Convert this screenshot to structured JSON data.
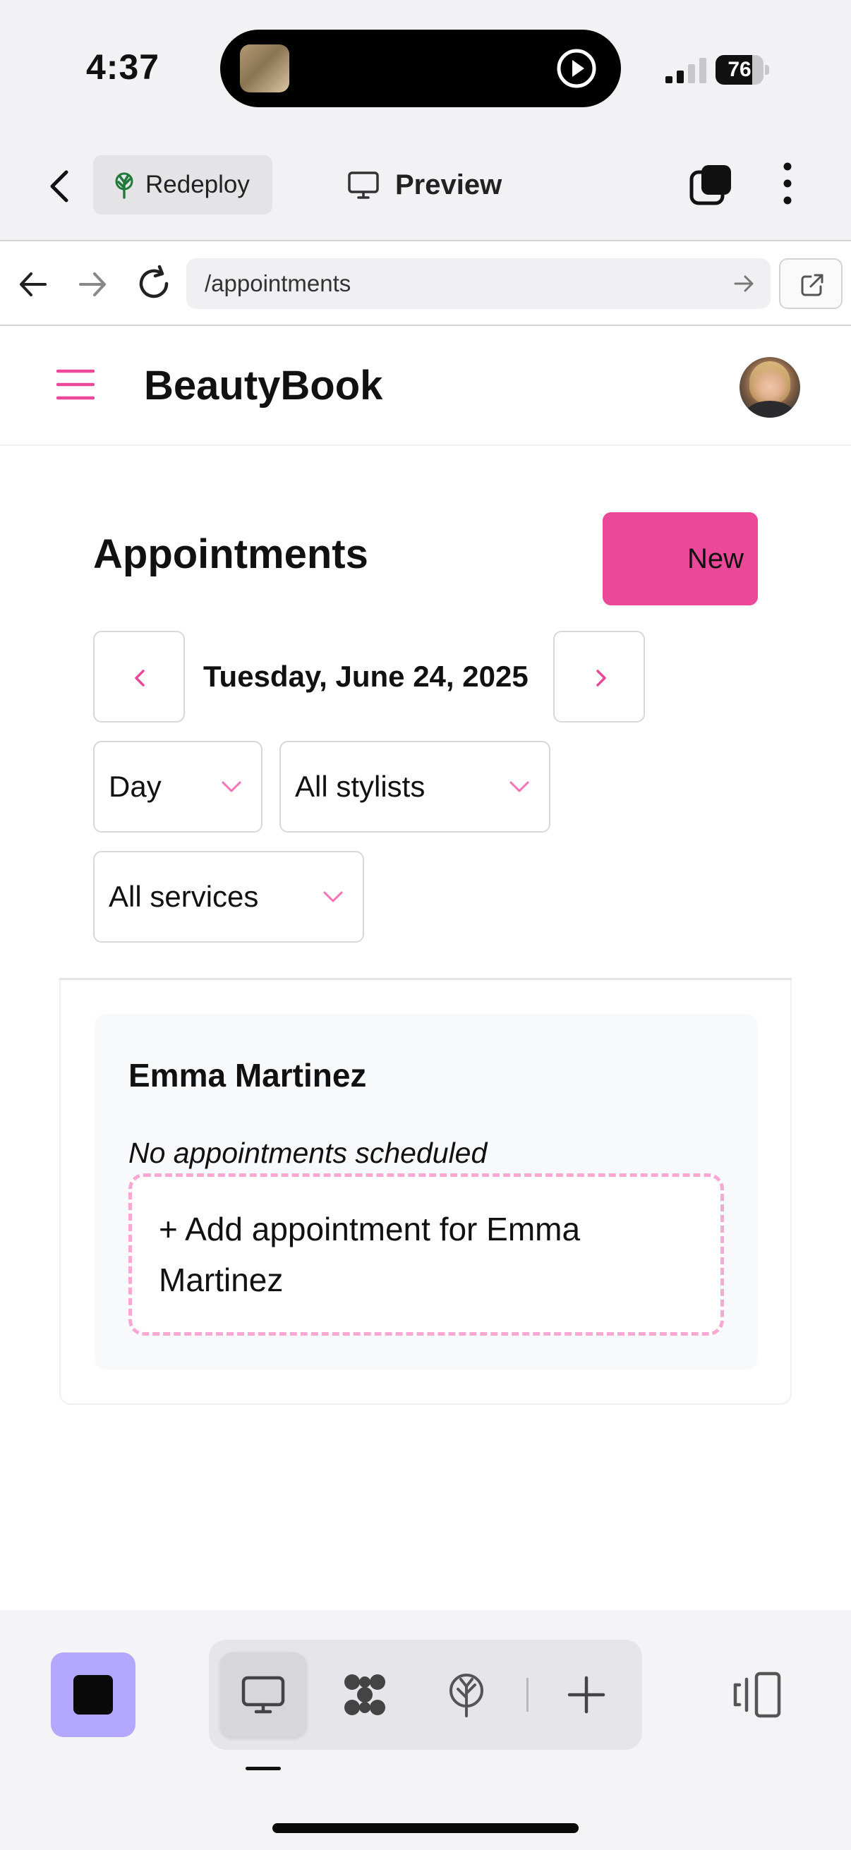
{
  "status_bar": {
    "time": "4:37",
    "battery": "76",
    "battery_level": 0.76
  },
  "app_bar": {
    "redeploy_label": "Redeploy",
    "preview_label": "Preview"
  },
  "browser": {
    "url": "/appointments"
  },
  "site": {
    "brand": "BeautyBook"
  },
  "page": {
    "title": "Appointments",
    "new_button_label": "New",
    "date_label": "Tuesday, June 24, 2025",
    "view_select": "Day",
    "stylist_select": "All stylists",
    "service_select": "All services"
  },
  "schedule": {
    "stylists": [
      {
        "name": "Emma Martinez",
        "empty_note": "No appointments scheduled",
        "add_label": "+ Add appointment for Emma Martinez"
      }
    ]
  },
  "colors": {
    "accent": "#ec4899",
    "accent_light": "#f9a8d4",
    "stop_button": "#b4a7ff"
  },
  "icons": {
    "back": "chevron-left-icon",
    "redeploy": "tree-icon",
    "preview": "monitor-icon",
    "tabs": "tabs-icon",
    "more": "more-vertical-icon",
    "menu": "hamburger-icon",
    "prev_day": "chevron-left-icon",
    "next_day": "chevron-right-icon",
    "dropdown": "chevron-down-icon"
  }
}
